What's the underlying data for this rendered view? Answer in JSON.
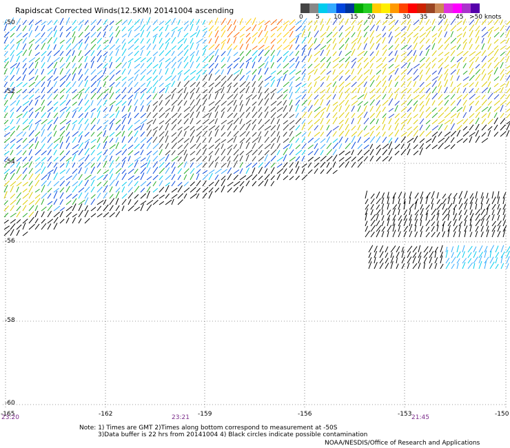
{
  "title": "Rapidscat Corrected Winds(12.5KM) 20141004 ascending",
  "legend": {
    "labels": [
      "0",
      "5",
      "10",
      "15",
      "20",
      "25",
      "30",
      "35",
      "40",
      "45",
      ">50 knots"
    ],
    "colors": [
      "#444444",
      "#888888",
      "#00ccee",
      "#33aaff",
      "#0044dd",
      "#003399",
      "#00aa00",
      "#22cc22",
      "#ffcc00",
      "#ffee00",
      "#ff9900",
      "#ff4400",
      "#ff0000",
      "#cc2200",
      "#994422",
      "#cc8855",
      "#dd33dd",
      "#ff00ff",
      "#aa33cc",
      "#5500aa"
    ]
  },
  "axes": {
    "lat_labels": [
      "-50",
      "-52",
      "-54",
      "-56",
      "-58",
      "-60"
    ],
    "lon_labels": [
      "-165",
      "-162",
      "-159",
      "-156",
      "-153",
      "-150"
    ],
    "time_labels": [
      "23:20",
      "23:21",
      "21:45"
    ]
  },
  "grid": "dotted",
  "notes": {
    "line1": "Note: 1) Times are GMT 2)Times along bottom correspond to measurement at -50S",
    "line2": "3)Data buffer is 22 hrs from 20141004 4) Black circles indicate possible contamination"
  },
  "credit": "NOAA/NESDIS/Office of Research and Applications"
}
